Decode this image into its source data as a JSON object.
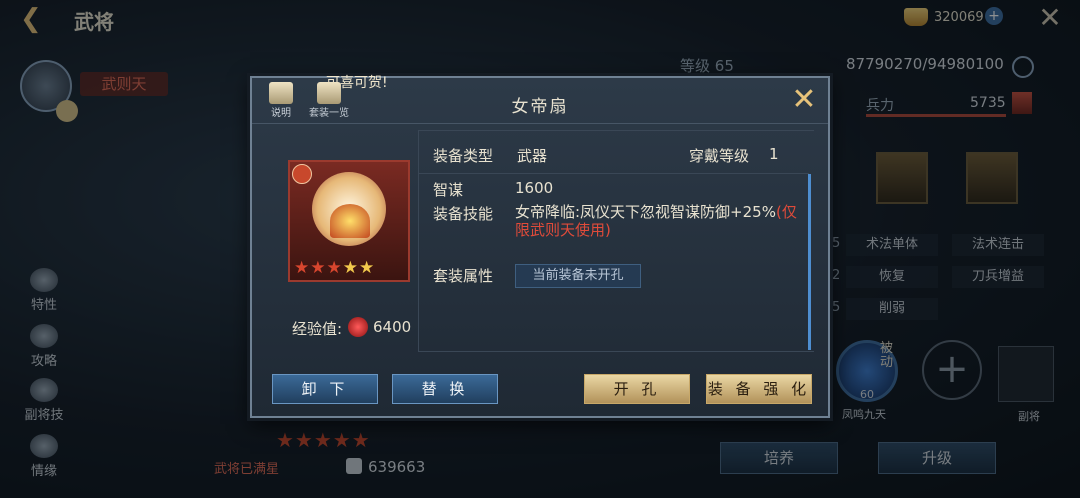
{
  "header": {
    "title": "武将",
    "gold_amount": "320069"
  },
  "hero": {
    "name": "武则天",
    "level_label": "等级",
    "level": "65",
    "exp": "87790270/94980100",
    "troops_label": "兵力",
    "troops": "5735",
    "full_star_label": "武将已满星",
    "power": "639663"
  },
  "side_menu": [
    {
      "label": "特性",
      "icon": "trait-icon"
    },
    {
      "label": "攻略",
      "icon": "guide-icon"
    },
    {
      "label": "副将技",
      "icon": "vice-skill-icon"
    },
    {
      "label": "情缘",
      "icon": "bond-icon"
    }
  ],
  "skill_tags": [
    "术法单体",
    "法术连击",
    "恢复",
    "刀兵增益",
    "削弱"
  ],
  "skill_numbers": [
    "5",
    "2",
    "5"
  ],
  "passive": {
    "badge": "被动",
    "level": "60",
    "name": "凤鸣九天"
  },
  "vice_label": "副将",
  "bottom_buttons": {
    "train": "培养",
    "upgrade": "升级"
  },
  "modal": {
    "congrats": "可喜可贺!",
    "tool_help": "说明",
    "tool_sets": "套装一览",
    "title": "女帝扇",
    "equip_type_label": "装备类型",
    "equip_type_value": "武器",
    "wear_level_label": "穿戴等级",
    "wear_level_value": "1",
    "stat_label": "智谋",
    "stat_value": "1600",
    "skill_label": "装备技能",
    "skill_text": "女帝降临:凤仪天下忽视智谋防御+25%",
    "skill_limit": "(仅限武则天使用)",
    "set_label": "套装属性",
    "set_status": "当前装备未开孔",
    "exp_label": "经验值:",
    "exp_value": "6400",
    "stars_filled": 5,
    "buttons": {
      "unequip": "卸 下",
      "replace": "替 换",
      "socket": "开 孔",
      "enhance": "装 备 强 化"
    }
  },
  "colors": {
    "accent_gold": "#e6c27a",
    "limit_red": "#e04b3a",
    "scroll_blue": "#4e8ed0"
  }
}
